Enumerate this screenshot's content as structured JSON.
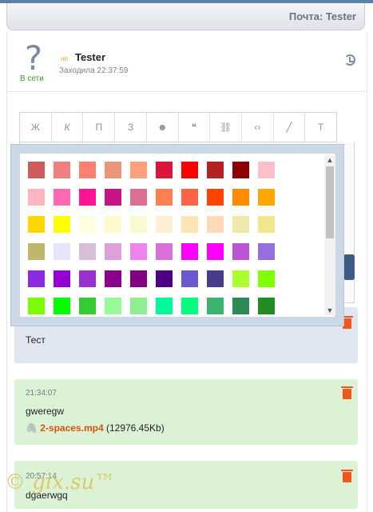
{
  "header": {
    "title": "Почта: Tester"
  },
  "user": {
    "avatar_glyph": "?",
    "status_label": "В сети",
    "on_indicator": "on",
    "name": "Tester",
    "last_seen": "Заходила 22:37:59"
  },
  "toolbar": {
    "buttons": [
      {
        "label": "Ж"
      },
      {
        "label": "К"
      },
      {
        "label": "П"
      },
      {
        "label": "З"
      },
      {
        "label": "☻"
      },
      {
        "label": "❝"
      },
      {
        "label": "⛓"
      },
      {
        "label": "‹›"
      },
      {
        "label": "╱"
      },
      {
        "label": "T"
      }
    ]
  },
  "palette": {
    "colors": [
      "#cd5c5c",
      "#f08080",
      "#fa8072",
      "#e9967a",
      "#ffa07a",
      "#dc143c",
      "#ff0000",
      "#b22222",
      "#8b0000",
      "#ffc0cb",
      "#ffb6c1",
      "#ff69b4",
      "#ff1493",
      "#c71585",
      "#db7093",
      "#ff7f50",
      "#ff6347",
      "#ff4500",
      "#ff8c00",
      "#ffa500",
      "#ffd700",
      "#ffff00",
      "#ffffe0",
      "#fffacd",
      "#fafad2",
      "#ffefd5",
      "#ffe4b5",
      "#ffdab9",
      "#eee8aa",
      "#f0e68c",
      "#bdb76b",
      "#e6e6fa",
      "#d8bfd8",
      "#dda0dd",
      "#ee82ee",
      "#da70d6",
      "#ff00ff",
      "#ff00ff",
      "#ba55d3",
      "#9370db",
      "#8a2be2",
      "#9400d3",
      "#9932cc",
      "#8b008b",
      "#800080",
      "#4b0082",
      "#6a5acd",
      "#483d8b",
      "#adff2f",
      "#7fff00",
      "#7cfc00",
      "#00ff00",
      "#32cd32",
      "#98fb98",
      "#90ee90",
      "#00fa9a",
      "#00ff7f",
      "#3cb371",
      "#2e8b57",
      "#228b22",
      "#008000",
      "#006400",
      "#9acd32",
      "#6b8e23",
      "#808000",
      "#556b2f",
      "#66cdaa",
      "#8fbc8f",
      "#20b2aa",
      "#008b8b",
      "#008080",
      "#00ffff",
      "#00ffff",
      "#e0ffff",
      "#afeeee",
      "#7fffd4",
      "#40e0d0",
      "#48d1cc"
    ]
  },
  "messages": [
    {
      "time": "",
      "text": "Тест"
    },
    {
      "time": "21:34:07",
      "text": "gweregw",
      "attachment": {
        "name": "2-spaces.mp4",
        "size": "(12976.45Kb)"
      }
    },
    {
      "time": "20:57:14",
      "text": "dgaerwgq"
    }
  ],
  "watermark": "© gix.su™"
}
